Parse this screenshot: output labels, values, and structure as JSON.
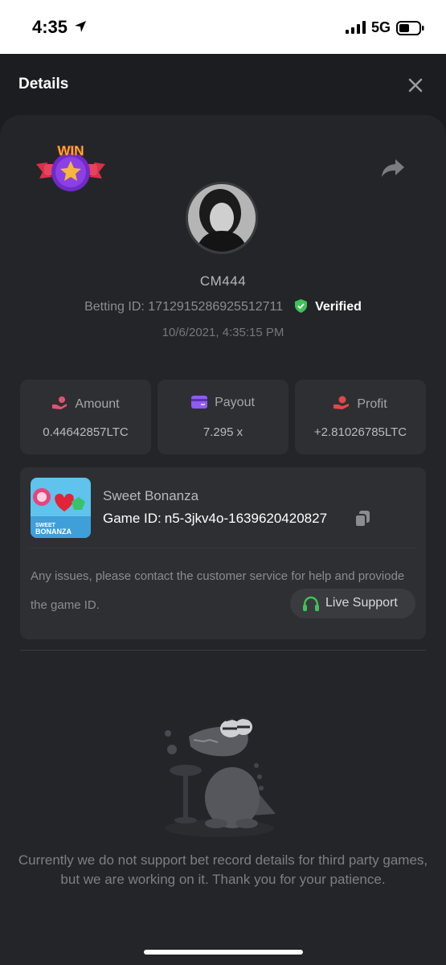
{
  "status_bar": {
    "time": "4:35",
    "network": "5G"
  },
  "header": {
    "title": "Details"
  },
  "bet": {
    "badge_text": "WIN",
    "username": "CM444",
    "betting_id_label": "Betting ID:",
    "betting_id": "1712915286925512711",
    "verified_label": "Verified",
    "datetime": "10/6/2021, 4:35:15 PM"
  },
  "stats": [
    {
      "label": "Amount",
      "value": "0.44642857LTC",
      "icon": "money-hand-icon",
      "color": "#e0536f"
    },
    {
      "label": "Payout",
      "value": "7.295 x",
      "icon": "card-icon",
      "color": "#8e5cf0"
    },
    {
      "label": "Profit",
      "value": "+2.81026785LTC",
      "icon": "coin-hand-icon",
      "color": "#e24848"
    }
  ],
  "game": {
    "name": "Sweet Bonanza",
    "id_label": "Game ID:",
    "id": "n5-3jkv4o-1639620420827",
    "thumb_text_top": "SWEET",
    "thumb_text_bottom": "BONANZA",
    "note": "Any issues, please contact the customer service for help and proviode the game ID.",
    "live_support_label": "Live Support"
  },
  "footer_message": "Currently we do not support bet record details for third party games, but we are working on it. Thank you for your patience.",
  "colors": {
    "background": "#1c1d20",
    "card": "#242528",
    "panel": "#2e2f33",
    "verified": "#3fc25a",
    "support_icon": "#3fc25a"
  }
}
